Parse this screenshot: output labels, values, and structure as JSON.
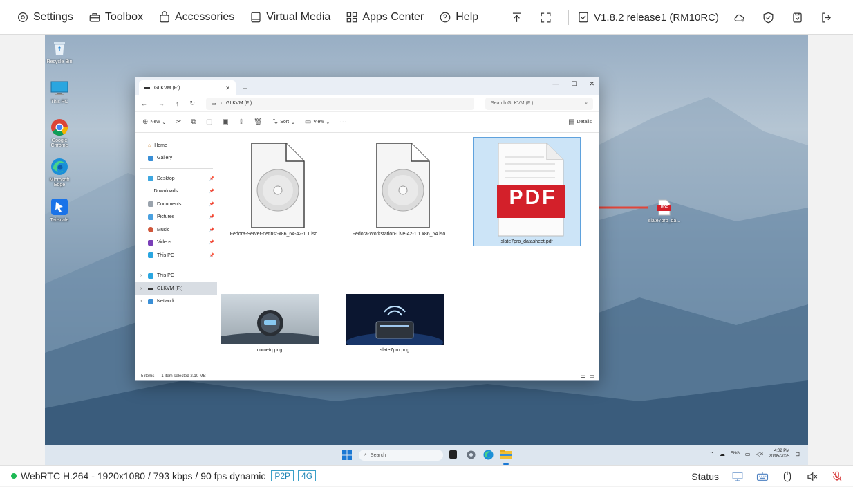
{
  "topnav": {
    "items": [
      {
        "label": "Settings",
        "icon": "gear-icon"
      },
      {
        "label": "Toolbox",
        "icon": "toolbox-icon"
      },
      {
        "label": "Accessories",
        "icon": "bag-icon"
      },
      {
        "label": "Virtual Media",
        "icon": "disk-icon"
      },
      {
        "label": "Apps Center",
        "icon": "grid-icon"
      },
      {
        "label": "Help",
        "icon": "help-icon"
      }
    ],
    "version": "V1.8.2 release1 (RM10RC)"
  },
  "desktop": {
    "icons": [
      {
        "label": "Recycle Bin"
      },
      {
        "label": "This PC"
      },
      {
        "label": "Google Chrome"
      },
      {
        "label": "Microsoft Edge"
      },
      {
        "label": "Tailscale"
      }
    ],
    "pdf_file": {
      "label": "slate7pro_da...",
      "badge": "PDF"
    }
  },
  "explorer": {
    "tab_title": "GLKVM (F:)",
    "address": "GLKVM (F:)",
    "search_placeholder": "Search GLKVM (F:)",
    "commands": {
      "new": "New",
      "sort": "Sort",
      "view": "View",
      "details": "Details"
    },
    "nav": {
      "quick": [
        {
          "label": "Home"
        },
        {
          "label": "Gallery"
        }
      ],
      "pinned": [
        {
          "label": "Desktop"
        },
        {
          "label": "Downloads"
        },
        {
          "label": "Documents"
        },
        {
          "label": "Pictures"
        },
        {
          "label": "Music"
        },
        {
          "label": "Videos"
        },
        {
          "label": "This PC"
        }
      ],
      "tree": [
        {
          "label": "This PC"
        },
        {
          "label": "GLKVM (F:)"
        },
        {
          "label": "Network"
        }
      ]
    },
    "files": [
      {
        "name": "Fedora-Server-netinst-x86_64-42-1.1.iso"
      },
      {
        "name": "Fedora-Workstation-Live-42-1.1.x86_64.iso"
      },
      {
        "name": "slate7pro_datasheet.pdf",
        "badge": "PDF"
      },
      {
        "name": "cometq.png"
      },
      {
        "name": "slate7pro.png"
      }
    ],
    "status": {
      "count": "5 items",
      "selection": "1 item selected  2.10 MB"
    }
  },
  "taskbar": {
    "search": "Search",
    "lang": "ENG",
    "time": "4:02 PM",
    "date": "20/05/2025"
  },
  "statusbar": {
    "stream": "WebRTC H.264 - 1920x1080 / 793 kbps / 90 fps dynamic",
    "badge_p2p": "P2P",
    "badge_net": "4G",
    "status_label": "Status"
  },
  "colors": {
    "accent": "#3aa0c8",
    "pdf_red": "#d3202a",
    "online": "#1db954",
    "arrow": "#e0463a"
  }
}
